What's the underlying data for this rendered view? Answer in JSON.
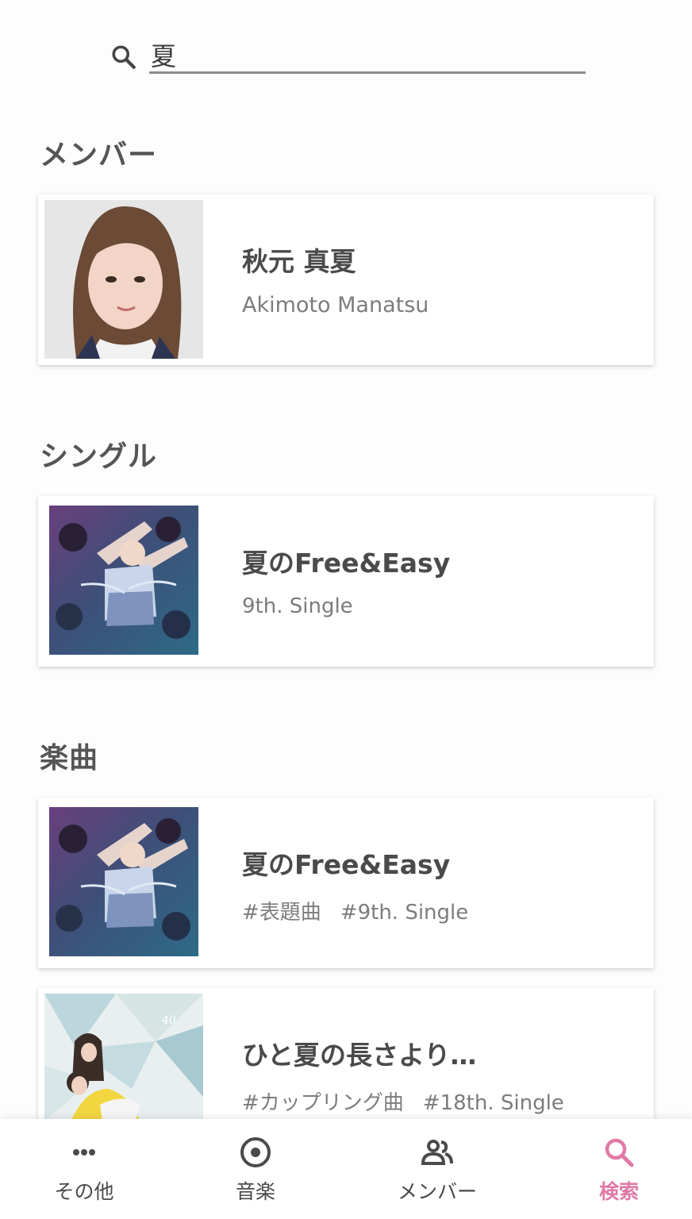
{
  "search": {
    "query": "夏"
  },
  "sections": {
    "members": {
      "title": "メンバー",
      "items": [
        {
          "name": "秋元 真夏",
          "romaji": "Akimoto Manatsu"
        }
      ]
    },
    "singles": {
      "title": "シングル",
      "items": [
        {
          "title": "夏のFree&Easy",
          "subtitle": "9th. Single"
        }
      ]
    },
    "songs": {
      "title": "楽曲",
      "items": [
        {
          "title": "夏のFree&Easy",
          "tags": [
            "#表題曲",
            "#9th. Single"
          ]
        },
        {
          "title": "ひと夏の長さより…",
          "tags": [
            "#カップリング曲",
            "#18th. Single"
          ]
        }
      ]
    }
  },
  "nav": {
    "items": [
      {
        "label": "その他",
        "icon": "more-icon"
      },
      {
        "label": "音楽",
        "icon": "music-disc-icon"
      },
      {
        "label": "メンバー",
        "icon": "people-icon"
      },
      {
        "label": "検索",
        "icon": "search-icon",
        "active": true
      }
    ],
    "active_color": "#e07aa6"
  }
}
